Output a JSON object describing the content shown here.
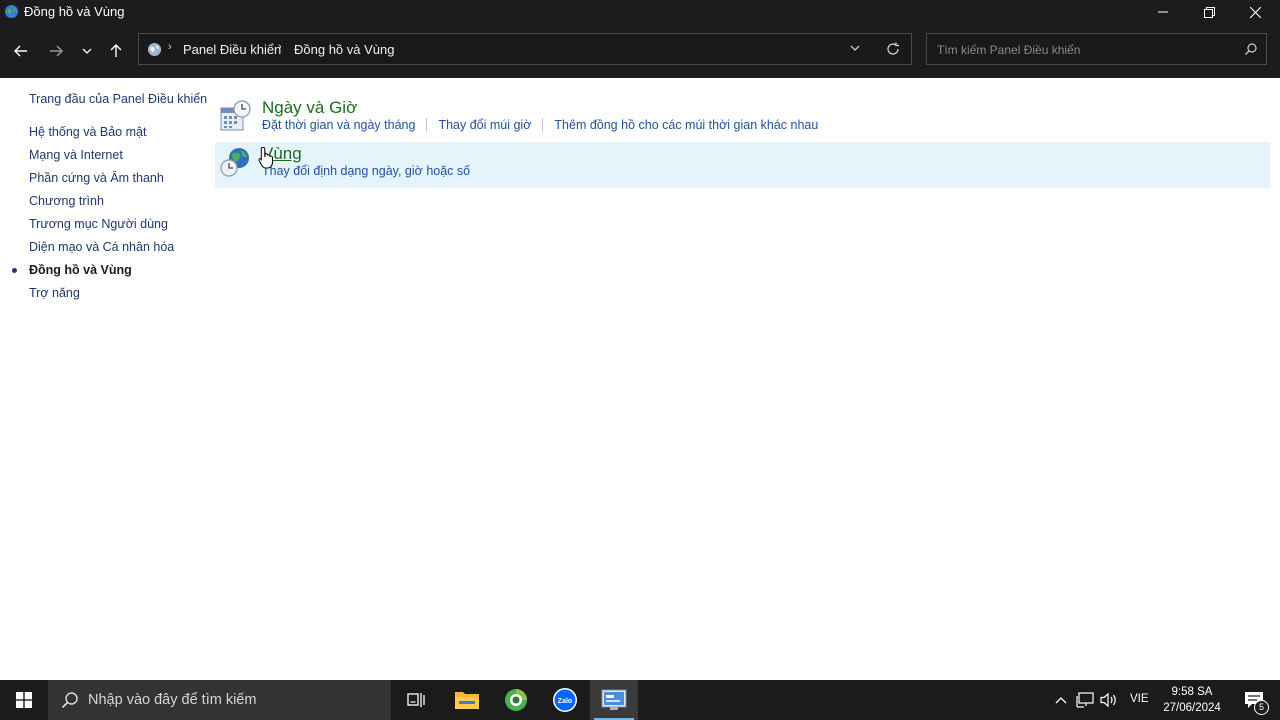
{
  "window": {
    "title": "Đồng hồ và Vùng"
  },
  "address": {
    "crumbs": [
      "Panel Điều khiển",
      "Đồng hồ và Vùng"
    ]
  },
  "search": {
    "placeholder": "Tìm kiếm Panel Điều khiển"
  },
  "sidebar": {
    "home": "Trang đầu của Panel Điều khiển",
    "items": [
      {
        "label": "Hệ thống và Bảo mật",
        "active": false
      },
      {
        "label": "Mạng và Internet",
        "active": false
      },
      {
        "label": "Phần cứng và Âm thanh",
        "active": false
      },
      {
        "label": "Chương trình",
        "active": false
      },
      {
        "label": "Trương mục Người dùng",
        "active": false
      },
      {
        "label": "Diện mạo và Cá nhân hóa",
        "active": false
      },
      {
        "label": "Đồng hồ và Vùng",
        "active": true
      },
      {
        "label": "Trợ năng",
        "active": false
      }
    ]
  },
  "categories": [
    {
      "title": "Ngày và Giờ",
      "icon": "clock-calendar-icon",
      "links": [
        "Đặt thời gian và ngày tháng",
        "Thay đổi múi giờ",
        "Thêm đồng hồ cho các múi thời gian khác nhau"
      ]
    },
    {
      "title": "Vùng",
      "icon": "globe-clock-icon",
      "links": [
        "Thay đổi định dạng ngày, giờ hoặc số"
      ]
    }
  ],
  "taskbar": {
    "search_placeholder": "Nhập vào đây để tìm kiếm",
    "language": "VIE",
    "time": "9:58 SA",
    "date": "27/06/2024",
    "notification_count": "5"
  },
  "colors": {
    "category_title": "#1e6b1e",
    "link": "#1f52a3",
    "hover_bg": "#e5f3fb",
    "chrome_bg": "#1c1c1c"
  }
}
